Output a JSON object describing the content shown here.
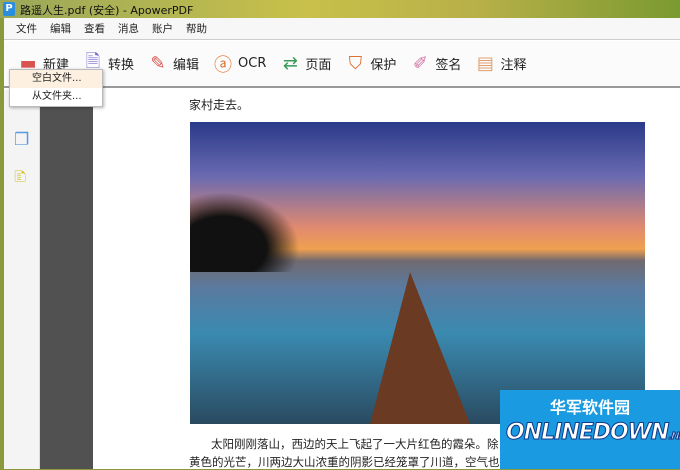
{
  "window": {
    "title": "路遥人生.pdf (安全) - ApowerPDF",
    "app_icon": "P"
  },
  "menu": [
    "文件",
    "编辑",
    "查看",
    "消息",
    "账户",
    "帮助"
  ],
  "toolbar": [
    {
      "label": "新建",
      "icon": "new-icon",
      "color": "#d9534f"
    },
    {
      "label": "转换",
      "icon": "convert-icon",
      "color": "#7a6ad0"
    },
    {
      "label": "编辑",
      "icon": "edit-icon",
      "color": "#d9534f"
    },
    {
      "label": "OCR",
      "icon": "ocr-icon",
      "color": "#e07030"
    },
    {
      "label": "页面",
      "icon": "page-icon",
      "color": "#3a9a5a"
    },
    {
      "label": "保护",
      "icon": "protect-icon",
      "color": "#e07030"
    },
    {
      "label": "签名",
      "icon": "sign-icon",
      "color": "#d070a0"
    },
    {
      "label": "注释",
      "icon": "comment-icon",
      "color": "#e0a070"
    }
  ],
  "dropdown": [
    "空白文件...",
    "从文件夹..."
  ],
  "document": {
    "line_top": "家村走去。",
    "para1": "太阳刚刚落山，西边的天上飞起了一大片红色的霞朵。除",
    "para2": "黄色的光芒，川两边大山浓重的阴影已经笼罩了川道，空气也"
  },
  "watermark": {
    "cn": "华军软件园",
    "en": "ONLINEDOWN",
    "net": ".NET"
  }
}
